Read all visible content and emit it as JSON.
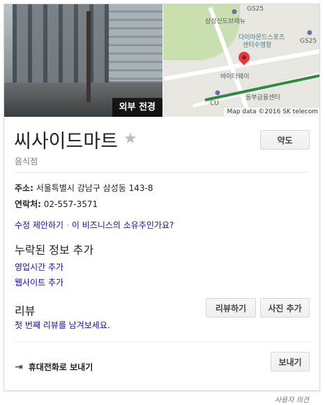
{
  "photo": {
    "label": "외부 전경"
  },
  "map": {
    "labels": {
      "gs25_top": "GS25",
      "station": "삼성신도브래뉴",
      "diamond": "다이아몬드스포츠",
      "diamond2": "센터수영장",
      "gs25_right": "GS25",
      "bakery": "바이더웨이",
      "cu": "CU",
      "finance": "동부금융센터"
    },
    "attribution": "Map data ©2016 SK telecom"
  },
  "business": {
    "name": "씨사이드마트",
    "category": "음식점",
    "directions_label": "약도"
  },
  "info": {
    "address_label": "주소:",
    "address_value": "서울특별시 강남구 삼성동 143-8",
    "phone_label": "연락처:",
    "phone_value": "02-557-3571"
  },
  "actions": {
    "suggest_edit": "수정 제안하기",
    "separator": "·",
    "own_business": "이 비즈니스의 소유주인가요?"
  },
  "missing_info": {
    "title": "누락된 정보 추가",
    "hours": "영업시간 추가",
    "website": "웹사이트 추가"
  },
  "reviews": {
    "title": "리뷰",
    "write_review": "리뷰하기",
    "add_photo": "사진 추가",
    "first_review": "첫 번째 리뷰를 남겨보세요."
  },
  "send": {
    "label": "휴대전화로 보내기",
    "button": "보내기"
  },
  "footer": {
    "feedback": "사용자 의견"
  }
}
